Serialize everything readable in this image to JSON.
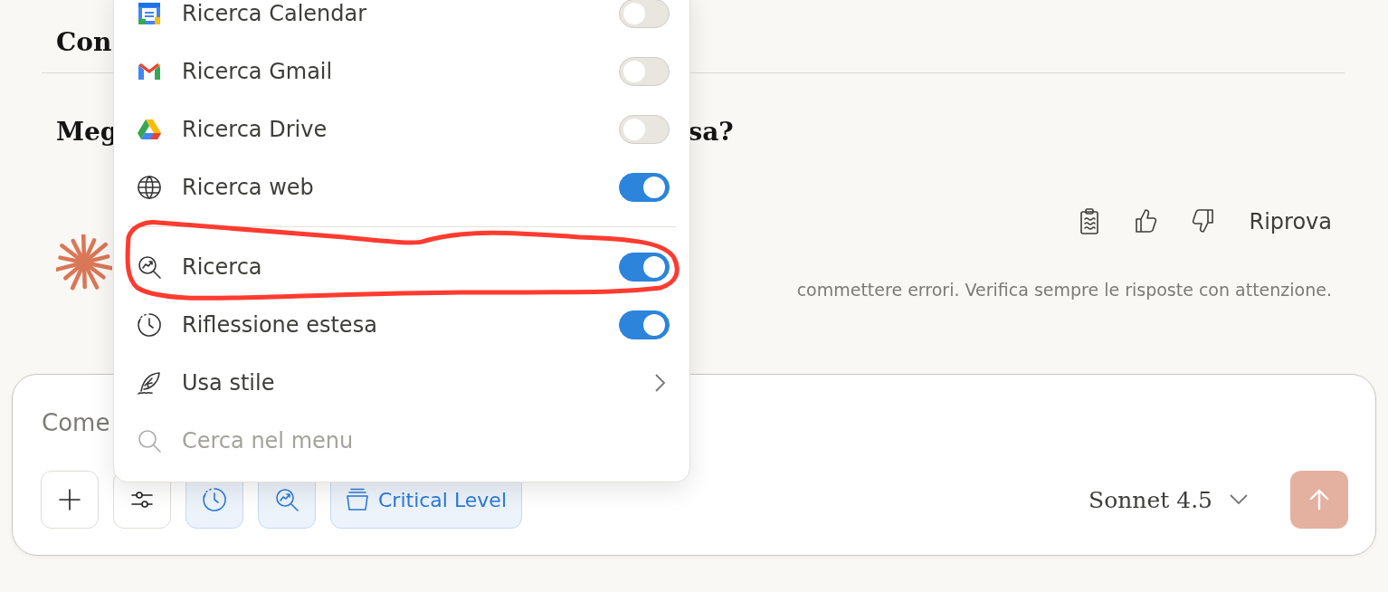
{
  "conversation": {
    "heading_1": "Con",
    "heading_2_parts": [
      "Meg",
      "sa?"
    ],
    "actions": [
      {
        "kind": "copy"
      },
      {
        "kind": "like"
      },
      {
        "kind": "dislike"
      },
      {
        "kind": "retry",
        "label": "Riprova"
      }
    ],
    "disclaimer": "commettere errori. Verifica sempre le risposte con attenzione."
  },
  "composer": {
    "placeholder": "Come",
    "tools": [
      {
        "kind": "add",
        "active": false
      },
      {
        "kind": "tools",
        "active": false
      },
      {
        "kind": "thinking",
        "active": true
      },
      {
        "kind": "research",
        "active": true
      },
      {
        "kind": "style",
        "label": "Critical Level",
        "active": true
      }
    ],
    "model": "Sonnet 4.5",
    "send_enabled": false
  },
  "menu": {
    "connectors": [
      {
        "kind": "calendar",
        "label": "Ricerca Calendar",
        "on": false
      },
      {
        "kind": "gmail",
        "label": "Ricerca Gmail",
        "on": false
      },
      {
        "kind": "drive",
        "label": "Ricerca Drive",
        "on": false
      },
      {
        "kind": "web",
        "label": "Ricerca web",
        "on": true
      }
    ],
    "features": [
      {
        "kind": "research",
        "label": "Ricerca",
        "on": true
      },
      {
        "kind": "thinking",
        "label": "Riflessione estesa",
        "on": true
      }
    ],
    "style_item": {
      "label": "Usa stile"
    },
    "search": {
      "placeholder": "Cerca nel menu"
    }
  },
  "annotation": {
    "kind": "freehand-loop"
  }
}
